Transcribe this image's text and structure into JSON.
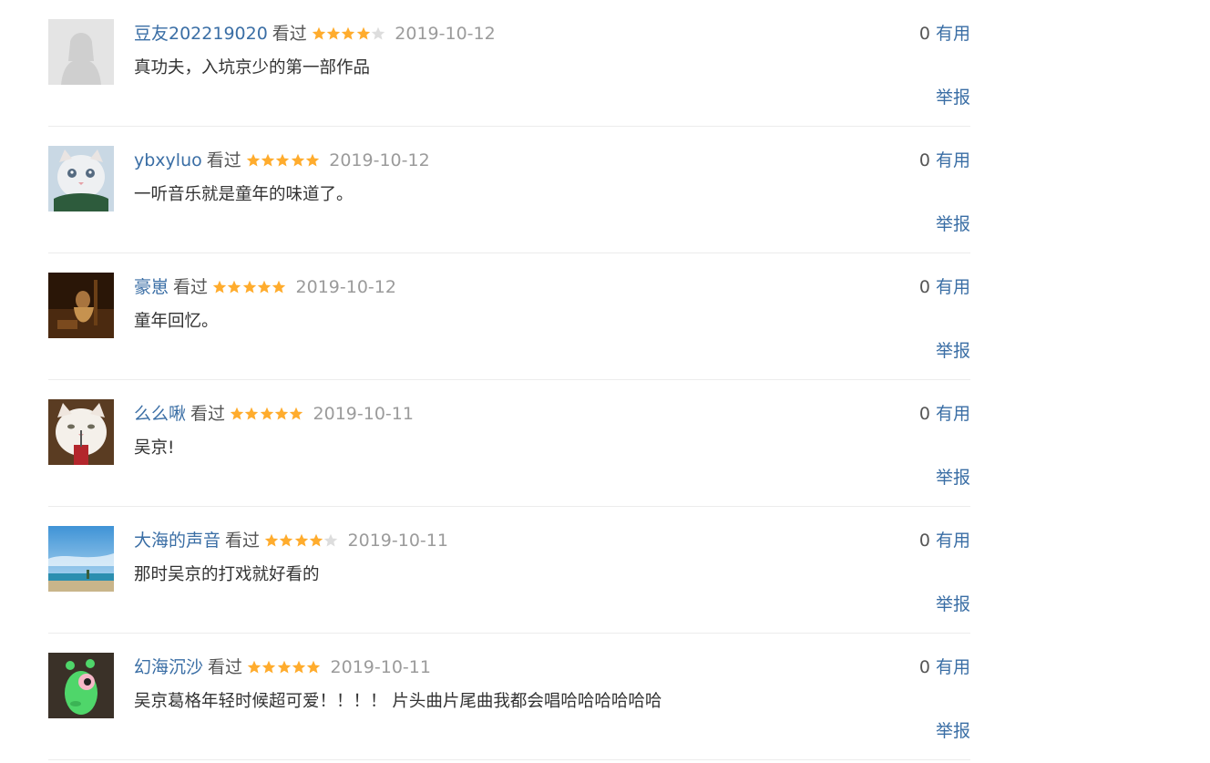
{
  "comments": [
    {
      "avatar": "default-avatar",
      "username": "豆友202219020",
      "status": "看过",
      "rating": 4,
      "date": "2019-10-12",
      "text": "真功夫，入坑京少的第一部作品",
      "vote_count": "0",
      "useful_label": "有用",
      "report_label": "举报"
    },
    {
      "avatar": "white-cat-avatar",
      "username": "ybxyluo",
      "status": "看过",
      "rating": 5,
      "date": "2019-10-12",
      "text": "一听音乐就是童年的味道了。",
      "vote_count": "0",
      "useful_label": "有用",
      "report_label": "举报"
    },
    {
      "avatar": "dark-photo-avatar",
      "username": "豪崽",
      "status": "看过",
      "rating": 5,
      "date": "2019-10-12",
      "text": "童年回忆。",
      "vote_count": "0",
      "useful_label": "有用",
      "report_label": "举报"
    },
    {
      "avatar": "cat-with-cup-avatar",
      "username": "么么啾",
      "status": "看过",
      "rating": 5,
      "date": "2019-10-11",
      "text": "吴京!",
      "vote_count": "0",
      "useful_label": "有用",
      "report_label": "举报"
    },
    {
      "avatar": "sky-beach-avatar",
      "username": "大海的声音",
      "status": "看过",
      "rating": 4,
      "date": "2019-10-11",
      "text": "那时吴京的打戏就好看的",
      "vote_count": "0",
      "useful_label": "有用",
      "report_label": "举报"
    },
    {
      "avatar": "green-toy-avatar",
      "username": "幻海沉沙",
      "status": "看过",
      "rating": 5,
      "date": "2019-10-11",
      "text": "吴京葛格年轻时候超可爱！！！！ 片头曲片尾曲我都会唱哈哈哈哈哈哈",
      "vote_count": "0",
      "useful_label": "有用",
      "report_label": "举报"
    }
  ],
  "colors": {
    "link": "#3a6ea5",
    "star_filled": "#ffac2d",
    "star_empty": "#dddddd",
    "date": "#9b9b9b",
    "divider": "#ececec"
  },
  "max_rating": 5
}
